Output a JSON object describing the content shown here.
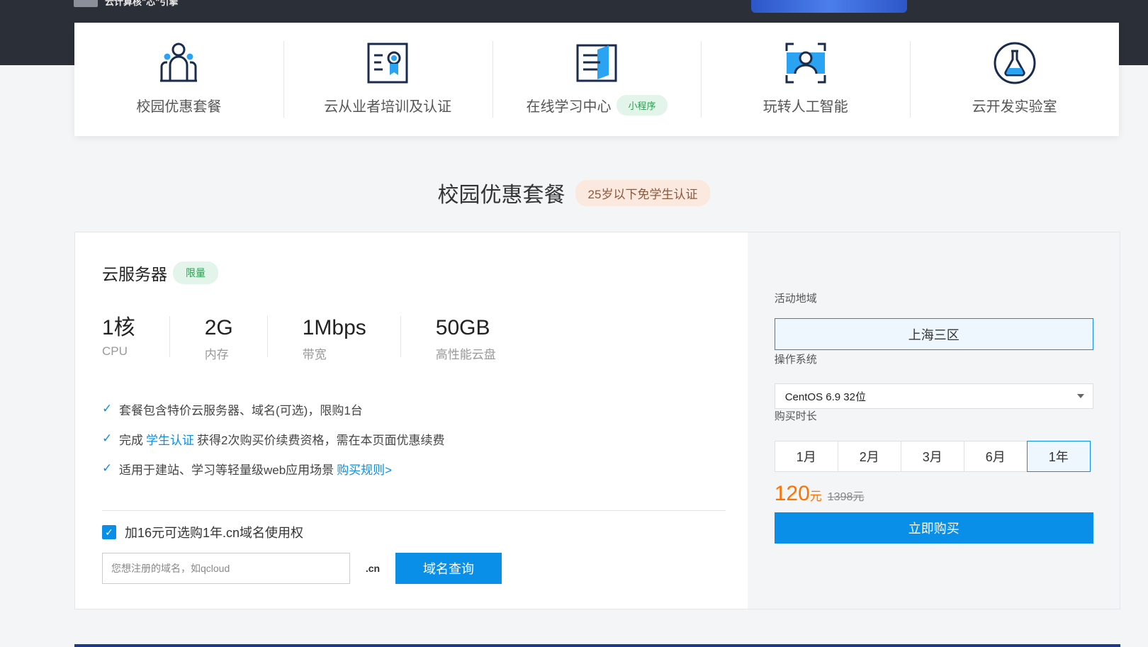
{
  "banner": {
    "tagline": "云计算核\"芯\"引擎"
  },
  "nav": {
    "items": [
      {
        "label": "校园优惠套餐",
        "icon": "campus-people-icon"
      },
      {
        "label": "云从业者培训及认证",
        "icon": "certificate-icon"
      },
      {
        "label": "在线学习中心",
        "icon": "book-icon",
        "badge": "小程序"
      },
      {
        "label": "玩转人工智能",
        "icon": "face-scan-icon"
      },
      {
        "label": "云开发实验室",
        "icon": "flask-icon"
      }
    ]
  },
  "section": {
    "title": "校园优惠套餐",
    "badge": "25岁以下免学生认证"
  },
  "product": {
    "name": "云服务器",
    "badge": "限量",
    "specs": [
      {
        "value": "1核",
        "label": "CPU"
      },
      {
        "value": "2G",
        "label": "内存"
      },
      {
        "value": "1Mbps",
        "label": "带宽"
      },
      {
        "value": "50GB",
        "label": "高性能云盘"
      }
    ],
    "features": {
      "f1": "套餐包含特价云服务器、域名(可选)，限购1台",
      "f2_pre": "完成",
      "f2_link": "学生认证",
      "f2_post": "获得2次购买价续费资格，需在本页面优惠续费",
      "f3_pre": "适用于建站、学习等轻量级web应用场景",
      "f3_link": "购买规则>"
    },
    "domain_option": "加16元可选购1年.cn域名使用权",
    "domain_placeholder": "您想注册的域名，如qcloud",
    "domain_suffix": ".cn",
    "query_button": "域名查询"
  },
  "order": {
    "region_label": "活动地域",
    "region_value": "上海三区",
    "os_label": "操作系统",
    "os_value": "CentOS 6.9 32位",
    "duration_label": "购买时长",
    "durations": [
      "1月",
      "2月",
      "3月",
      "6月",
      "1年"
    ],
    "selected_duration": "1年",
    "price": "120",
    "price_unit": "元",
    "original_price": "1398元",
    "buy_button": "立即购买"
  },
  "colors": {
    "accent": "#0a8fe8",
    "price": "#ff7200",
    "badge_green": "#2a9d4f"
  }
}
